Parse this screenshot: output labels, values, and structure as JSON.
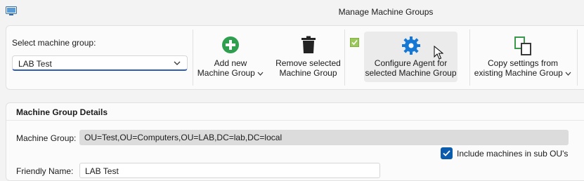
{
  "window": {
    "title": "Manage Machine Groups"
  },
  "toolbar": {
    "select_label": "Select machine group:",
    "selected_group": "LAB Test",
    "add_line1": "Add new",
    "add_line2": "Machine Group",
    "remove_line1": "Remove selected",
    "remove_line2": "Machine Group",
    "configure_line1": "Configure Agent for",
    "configure_line2": "selected Machine Group",
    "copy_line1": "Copy settings from",
    "copy_line2": "existing Machine Group"
  },
  "details": {
    "title": "Machine Group Details",
    "machine_group_label": "Machine Group:",
    "machine_group_value": "OU=Test,OU=Computers,OU=LAB,DC=lab,DC=local",
    "include_sub_label": "Include machines in sub OU's",
    "include_sub_checked": true,
    "friendly_name_label": "Friendly Name:",
    "friendly_name_value": "LAB Test"
  },
  "colors": {
    "accent": "#0b5cad",
    "add_icon": "#2e9e4f",
    "gear_icon": "#1478d4",
    "copy_icon": "#3a9a4b"
  }
}
